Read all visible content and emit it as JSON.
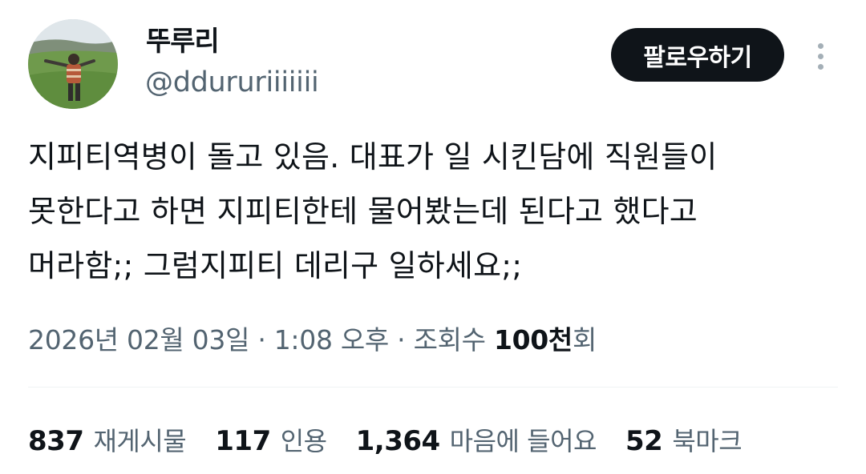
{
  "profile": {
    "display_name": "뚜루리",
    "handle": "@ddururiiiiiii",
    "follow_label": "팔로우하기"
  },
  "tweet": {
    "lines": [
      "지피티역병이 돌고 있음. 대표가 일 시킨담에 직원들이",
      "못한다고 하면 지피티한테 물어봤는데 된다고 했다고",
      "머라함;; 그럼지피티 데리구 일하세요;;"
    ]
  },
  "meta": {
    "date": "2026년 02월 03일",
    "separator": "·",
    "time": "1:08 오후",
    "views_label": "조회수",
    "views_count": "100천",
    "views_suffix": "회"
  },
  "stats": {
    "reposts": {
      "count": "837",
      "label": "재게시물"
    },
    "quotes": {
      "count": "117",
      "label": "인용"
    },
    "likes": {
      "count": "1,364",
      "label": "마음에 들어요"
    },
    "bookmarks": {
      "count": "52",
      "label": "북마크"
    }
  },
  "icons": {
    "more": "more-vertical-icon"
  },
  "colors": {
    "text_primary": "#0f1419",
    "text_secondary": "#536471",
    "button_bg": "#0f1419",
    "divider": "#eff3f4"
  }
}
